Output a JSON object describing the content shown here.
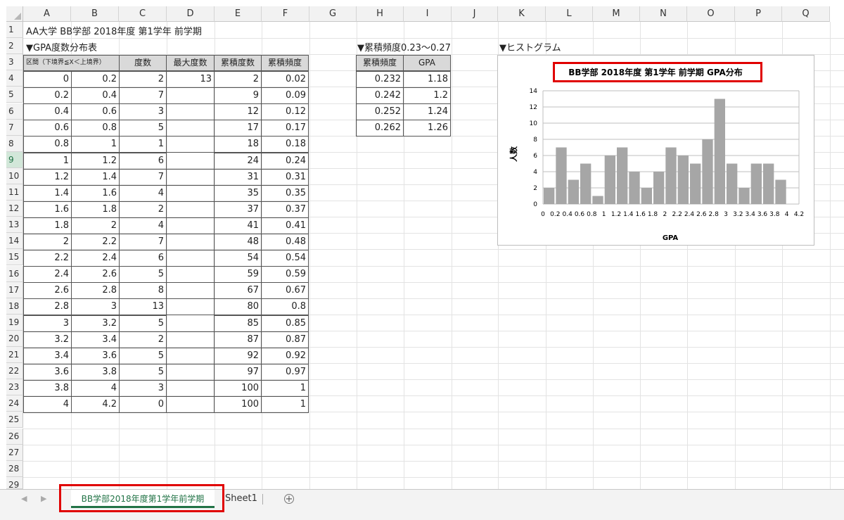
{
  "columns": [
    "A",
    "B",
    "C",
    "D",
    "E",
    "F",
    "G",
    "H",
    "I",
    "J",
    "K",
    "L",
    "M",
    "N",
    "O",
    "P",
    "Q"
  ],
  "rows": [
    "1",
    "2",
    "3",
    "4",
    "5",
    "6",
    "7",
    "8",
    "9",
    "10",
    "11",
    "12",
    "13",
    "14",
    "15",
    "16",
    "17",
    "18",
    "19",
    "20",
    "21",
    "22",
    "23",
    "24",
    "25",
    "26",
    "27",
    "28",
    "29"
  ],
  "sheet": {
    "a1_title": "AA大学 BB学部 2018年度 第1学年 前学期",
    "table_title": "▼GPA度数分布表",
    "table_headers": {
      "interval": "区間（下境界≦X＜上境界）",
      "freq": "度数",
      "max_freq": "最大度数",
      "cum_freq": "累積度数",
      "cum_rel": "累積頻度"
    },
    "table_rows": [
      {
        "low": "0",
        "high": "0.2",
        "freq": "2",
        "max": "13",
        "cum": "2",
        "rel": "0.02"
      },
      {
        "low": "0.2",
        "high": "0.4",
        "freq": "7",
        "max": "",
        "cum": "9",
        "rel": "0.09"
      },
      {
        "low": "0.4",
        "high": "0.6",
        "freq": "3",
        "max": "",
        "cum": "12",
        "rel": "0.12"
      },
      {
        "low": "0.6",
        "high": "0.8",
        "freq": "5",
        "max": "",
        "cum": "17",
        "rel": "0.17"
      },
      {
        "low": "0.8",
        "high": "1",
        "freq": "1",
        "max": "",
        "cum": "18",
        "rel": "0.18"
      },
      {
        "low": "1",
        "high": "1.2",
        "freq": "6",
        "max": "",
        "cum": "24",
        "rel": "0.24"
      },
      {
        "low": "1.2",
        "high": "1.4",
        "freq": "7",
        "max": "",
        "cum": "31",
        "rel": "0.31"
      },
      {
        "low": "1.4",
        "high": "1.6",
        "freq": "4",
        "max": "",
        "cum": "35",
        "rel": "0.35"
      },
      {
        "low": "1.6",
        "high": "1.8",
        "freq": "2",
        "max": "",
        "cum": "37",
        "rel": "0.37"
      },
      {
        "low": "1.8",
        "high": "2",
        "freq": "4",
        "max": "",
        "cum": "41",
        "rel": "0.41"
      },
      {
        "low": "2",
        "high": "2.2",
        "freq": "7",
        "max": "",
        "cum": "48",
        "rel": "0.48"
      },
      {
        "low": "2.2",
        "high": "2.4",
        "freq": "6",
        "max": "",
        "cum": "54",
        "rel": "0.54"
      },
      {
        "low": "2.4",
        "high": "2.6",
        "freq": "5",
        "max": "",
        "cum": "59",
        "rel": "0.59"
      },
      {
        "low": "2.6",
        "high": "2.8",
        "freq": "8",
        "max": "",
        "cum": "67",
        "rel": "0.67"
      },
      {
        "low": "2.8",
        "high": "3",
        "freq": "13",
        "max": "",
        "cum": "80",
        "rel": "0.8"
      },
      {
        "low": "3",
        "high": "3.2",
        "freq": "5",
        "max": "",
        "cum": "85",
        "rel": "0.85"
      },
      {
        "low": "3.2",
        "high": "3.4",
        "freq": "2",
        "max": "",
        "cum": "87",
        "rel": "0.87"
      },
      {
        "low": "3.4",
        "high": "3.6",
        "freq": "5",
        "max": "",
        "cum": "92",
        "rel": "0.92"
      },
      {
        "low": "3.6",
        "high": "3.8",
        "freq": "5",
        "max": "",
        "cum": "97",
        "rel": "0.97"
      },
      {
        "low": "3.8",
        "high": "4",
        "freq": "3",
        "max": "",
        "cum": "100",
        "rel": "1"
      },
      {
        "low": "4",
        "high": "4.2",
        "freq": "0",
        "max": "",
        "cum": "100",
        "rel": "1"
      }
    ],
    "cum_title": "▼累積頻度0.23〜0.27",
    "cum_headers": {
      "rel": "累積頻度",
      "gpa": "GPA"
    },
    "cum_rows": [
      {
        "rel": "0.232",
        "gpa": "1.18"
      },
      {
        "rel": "0.242",
        "gpa": "1.2"
      },
      {
        "rel": "0.252",
        "gpa": "1.24"
      },
      {
        "rel": "0.262",
        "gpa": "1.26"
      }
    ],
    "hist_title": "▼ヒストグラム"
  },
  "chart_data": {
    "type": "bar",
    "title": "BB学部 2018年度 第1学年 前学期 GPA分布",
    "xlabel": "GPA",
    "ylabel": "人数",
    "categories": [
      "0",
      "0.2",
      "0.4",
      "0.6",
      "0.8",
      "1",
      "1.2",
      "1.4",
      "1.6",
      "1.8",
      "2",
      "2.2",
      "2.4",
      "2.6",
      "2.8",
      "3",
      "3.2",
      "3.4",
      "3.6",
      "3.8",
      "4",
      "4.2"
    ],
    "values": [
      2,
      7,
      3,
      5,
      1,
      6,
      7,
      4,
      2,
      4,
      7,
      6,
      5,
      8,
      13,
      5,
      2,
      5,
      5,
      3,
      0
    ],
    "yticks": [
      "0",
      "2",
      "4",
      "6",
      "8",
      "10",
      "12",
      "14"
    ],
    "ylim": [
      0,
      14
    ],
    "grid": true,
    "bar_color": "#a6a6a6"
  },
  "tabs": {
    "active": "BB学部2018年度第1学年前学期",
    "other": "Sheet1",
    "add": "+",
    "prev": "◀",
    "next": "▶"
  },
  "colors": {
    "accent": "#217346",
    "highlight": "#e00000"
  }
}
